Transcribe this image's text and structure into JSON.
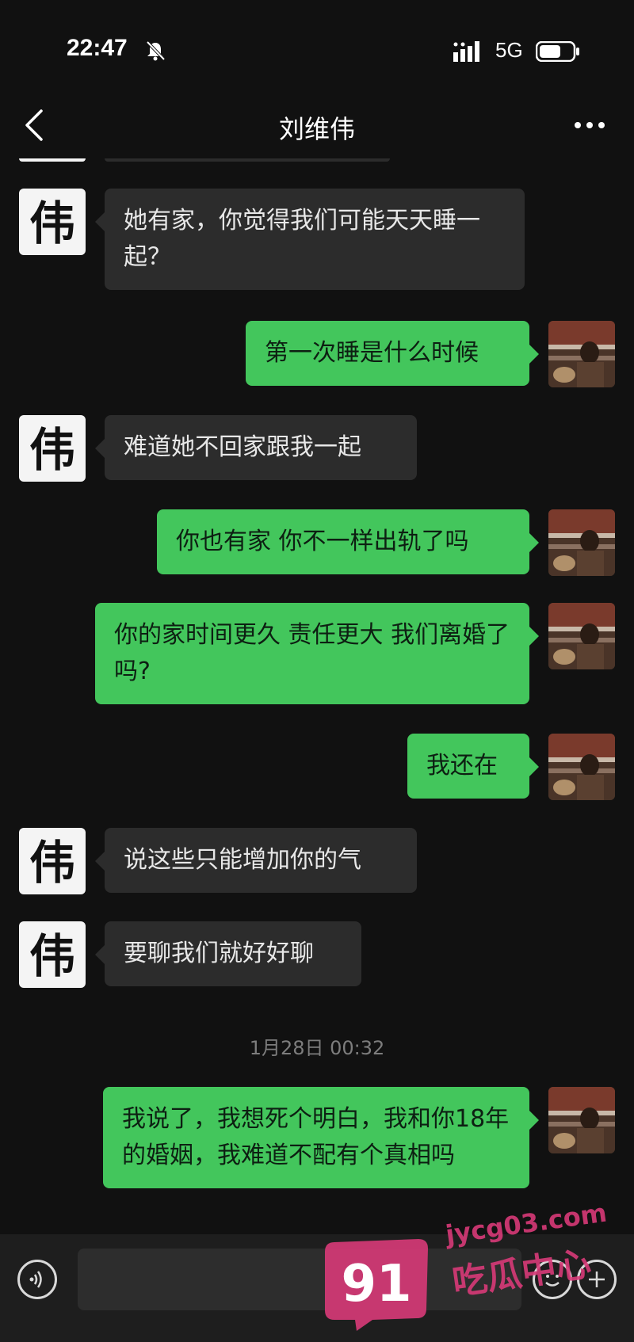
{
  "status_bar": {
    "time": "22:47",
    "network": "5G"
  },
  "header": {
    "title": "刘维伟"
  },
  "colors": {
    "background": "#111111",
    "incoming_bubble": "#2c2c2c",
    "outgoing_bubble": "#43c65c",
    "watermark": "#d83a78"
  },
  "messages": [
    {
      "from": "them",
      "text": "她有家，你觉得我们可能天天睡一起？"
    },
    {
      "from": "me",
      "text": "第一次睡是什么时候"
    },
    {
      "from": "them",
      "text": "难道她不回家跟我一起"
    },
    {
      "from": "me",
      "text": "你也有家 你不一样出轨了吗"
    },
    {
      "from": "me",
      "text": "你的家时间更久 责任更大 我们离婚了吗?"
    },
    {
      "from": "me",
      "text": "我还在"
    },
    {
      "from": "them",
      "text": "说这些只能增加你的气"
    },
    {
      "from": "them",
      "text": "要聊我们就好好聊"
    },
    {
      "from": "me",
      "text": "我说了，我想死个明白，我和你18年的婚姻，我难道不配有个真相吗"
    }
  ],
  "timestamp": "1月28日 00:32",
  "contact_avatar_glyph": "伟",
  "icons": {
    "back": "chevron-left-icon",
    "more": "more-dots-icon",
    "voice": "voice-icon",
    "emoji": "emoji-icon",
    "add": "plus-icon",
    "mute": "bell-off-icon"
  },
  "watermark": {
    "logo_number": "91",
    "domain": "jycg03.com",
    "name": "吃瓜中心"
  }
}
